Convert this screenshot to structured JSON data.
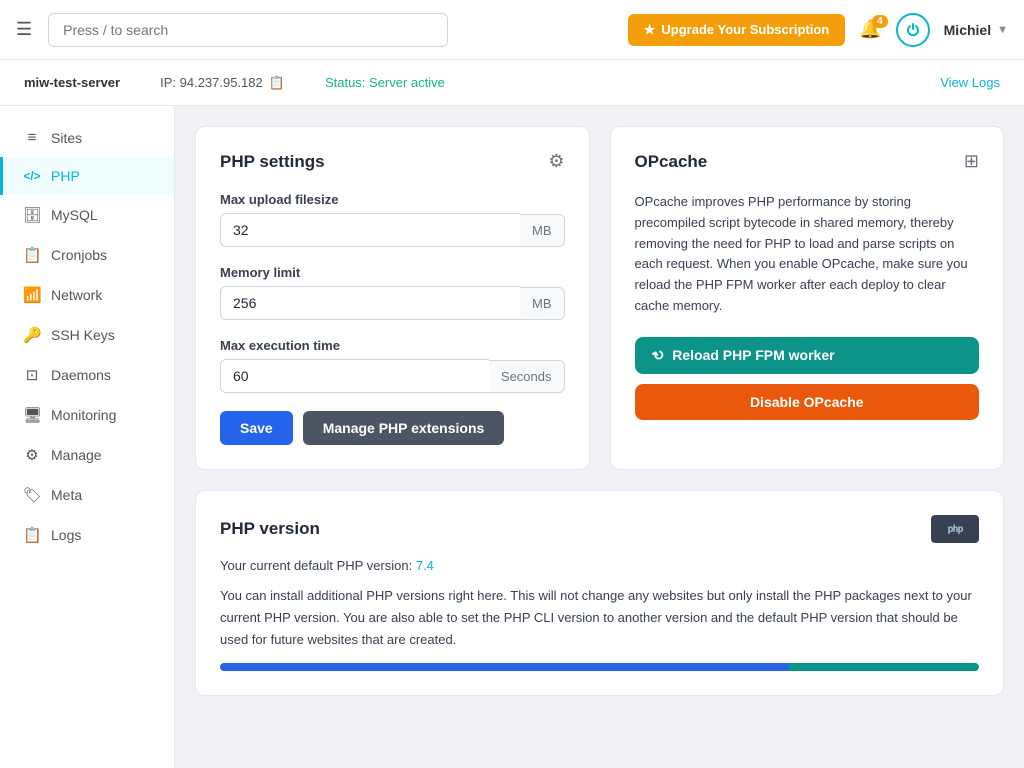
{
  "topnav": {
    "hamburger_label": "☰",
    "search_placeholder": "Press / to search",
    "upgrade_label": "Upgrade Your Subscription",
    "notif_count": "4",
    "user_name": "Michiel"
  },
  "server_bar": {
    "server_name": "miw-test-server",
    "ip_label": "IP: 94.237.95.182",
    "status_prefix": "Status: ",
    "status_value": "Server active",
    "view_logs_label": "View Logs"
  },
  "sidebar": {
    "items": [
      {
        "id": "sites",
        "label": "Sites",
        "icon": "≡"
      },
      {
        "id": "php",
        "label": "PHP",
        "icon": "</>"
      },
      {
        "id": "mysql",
        "label": "MySQL",
        "icon": "🗄"
      },
      {
        "id": "cronjobs",
        "label": "Cronjobs",
        "icon": "📋"
      },
      {
        "id": "network",
        "label": "Network",
        "icon": "📶"
      },
      {
        "id": "ssh-keys",
        "label": "SSH Keys",
        "icon": "🔑"
      },
      {
        "id": "daemons",
        "label": "Daemons",
        "icon": "⊡"
      },
      {
        "id": "monitoring",
        "label": "Monitoring",
        "icon": "🖥"
      },
      {
        "id": "manage",
        "label": "Manage",
        "icon": "⚙"
      },
      {
        "id": "meta",
        "label": "Meta",
        "icon": "🏷"
      },
      {
        "id": "logs",
        "label": "Logs",
        "icon": "📋"
      }
    ]
  },
  "php_settings": {
    "title": "PHP settings",
    "max_upload_label": "Max upload filesize",
    "max_upload_value": "32",
    "max_upload_unit": "MB",
    "memory_limit_label": "Memory limit",
    "memory_limit_value": "256",
    "memory_limit_unit": "MB",
    "max_execution_label": "Max execution time",
    "max_execution_value": "60",
    "max_execution_unit": "Seconds",
    "save_label": "Save",
    "manage_extensions_label": "Manage PHP extensions"
  },
  "opcache": {
    "title": "OPcache",
    "description": "OPcache improves PHP performance by storing precompiled script bytecode in shared memory, thereby removing the need for PHP to load and parse scripts on each request. When you enable OPcache, make sure you reload the PHP FPM worker after each deploy to clear cache memory.",
    "reload_label": "Reload PHP FPM worker",
    "disable_label": "Disable OPcache"
  },
  "php_version": {
    "title": "PHP version",
    "current_text_1": "Your current default PHP version: ",
    "current_version": "7.4",
    "install_text": "You can install additional PHP versions right here. This will not change any websites but only install the PHP packages next to your current PHP version. You are also able to set the PHP CLI version to another version and the default PHP version that should be used for future websites that are created."
  }
}
